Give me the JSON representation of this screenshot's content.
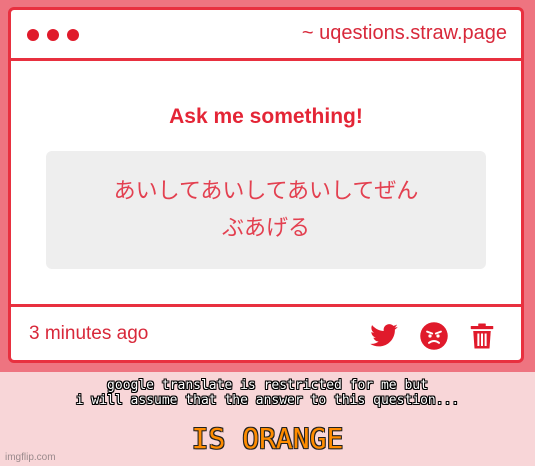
{
  "header": {
    "url": "~ uqestions.straw.page"
  },
  "card": {
    "title": "Ask me something!",
    "question_lines": [
      "あいしてあいしてあいしてぜん",
      "ぶあげる"
    ]
  },
  "footer": {
    "time": "3 minutes ago",
    "icons": [
      "twitter-icon",
      "angry-face-icon",
      "trash-icon"
    ]
  },
  "caption": {
    "lines": [
      "google translate is restricted for me but",
      "i will assume that the answer to this question..."
    ],
    "big": "IS ORANGE"
  },
  "watermark": "imgflip.com",
  "colors": {
    "accent": "#e8303f",
    "background_top": "#ee7480",
    "background_bottom": "#f8d6d8",
    "caption_big": "#ff8c00"
  }
}
